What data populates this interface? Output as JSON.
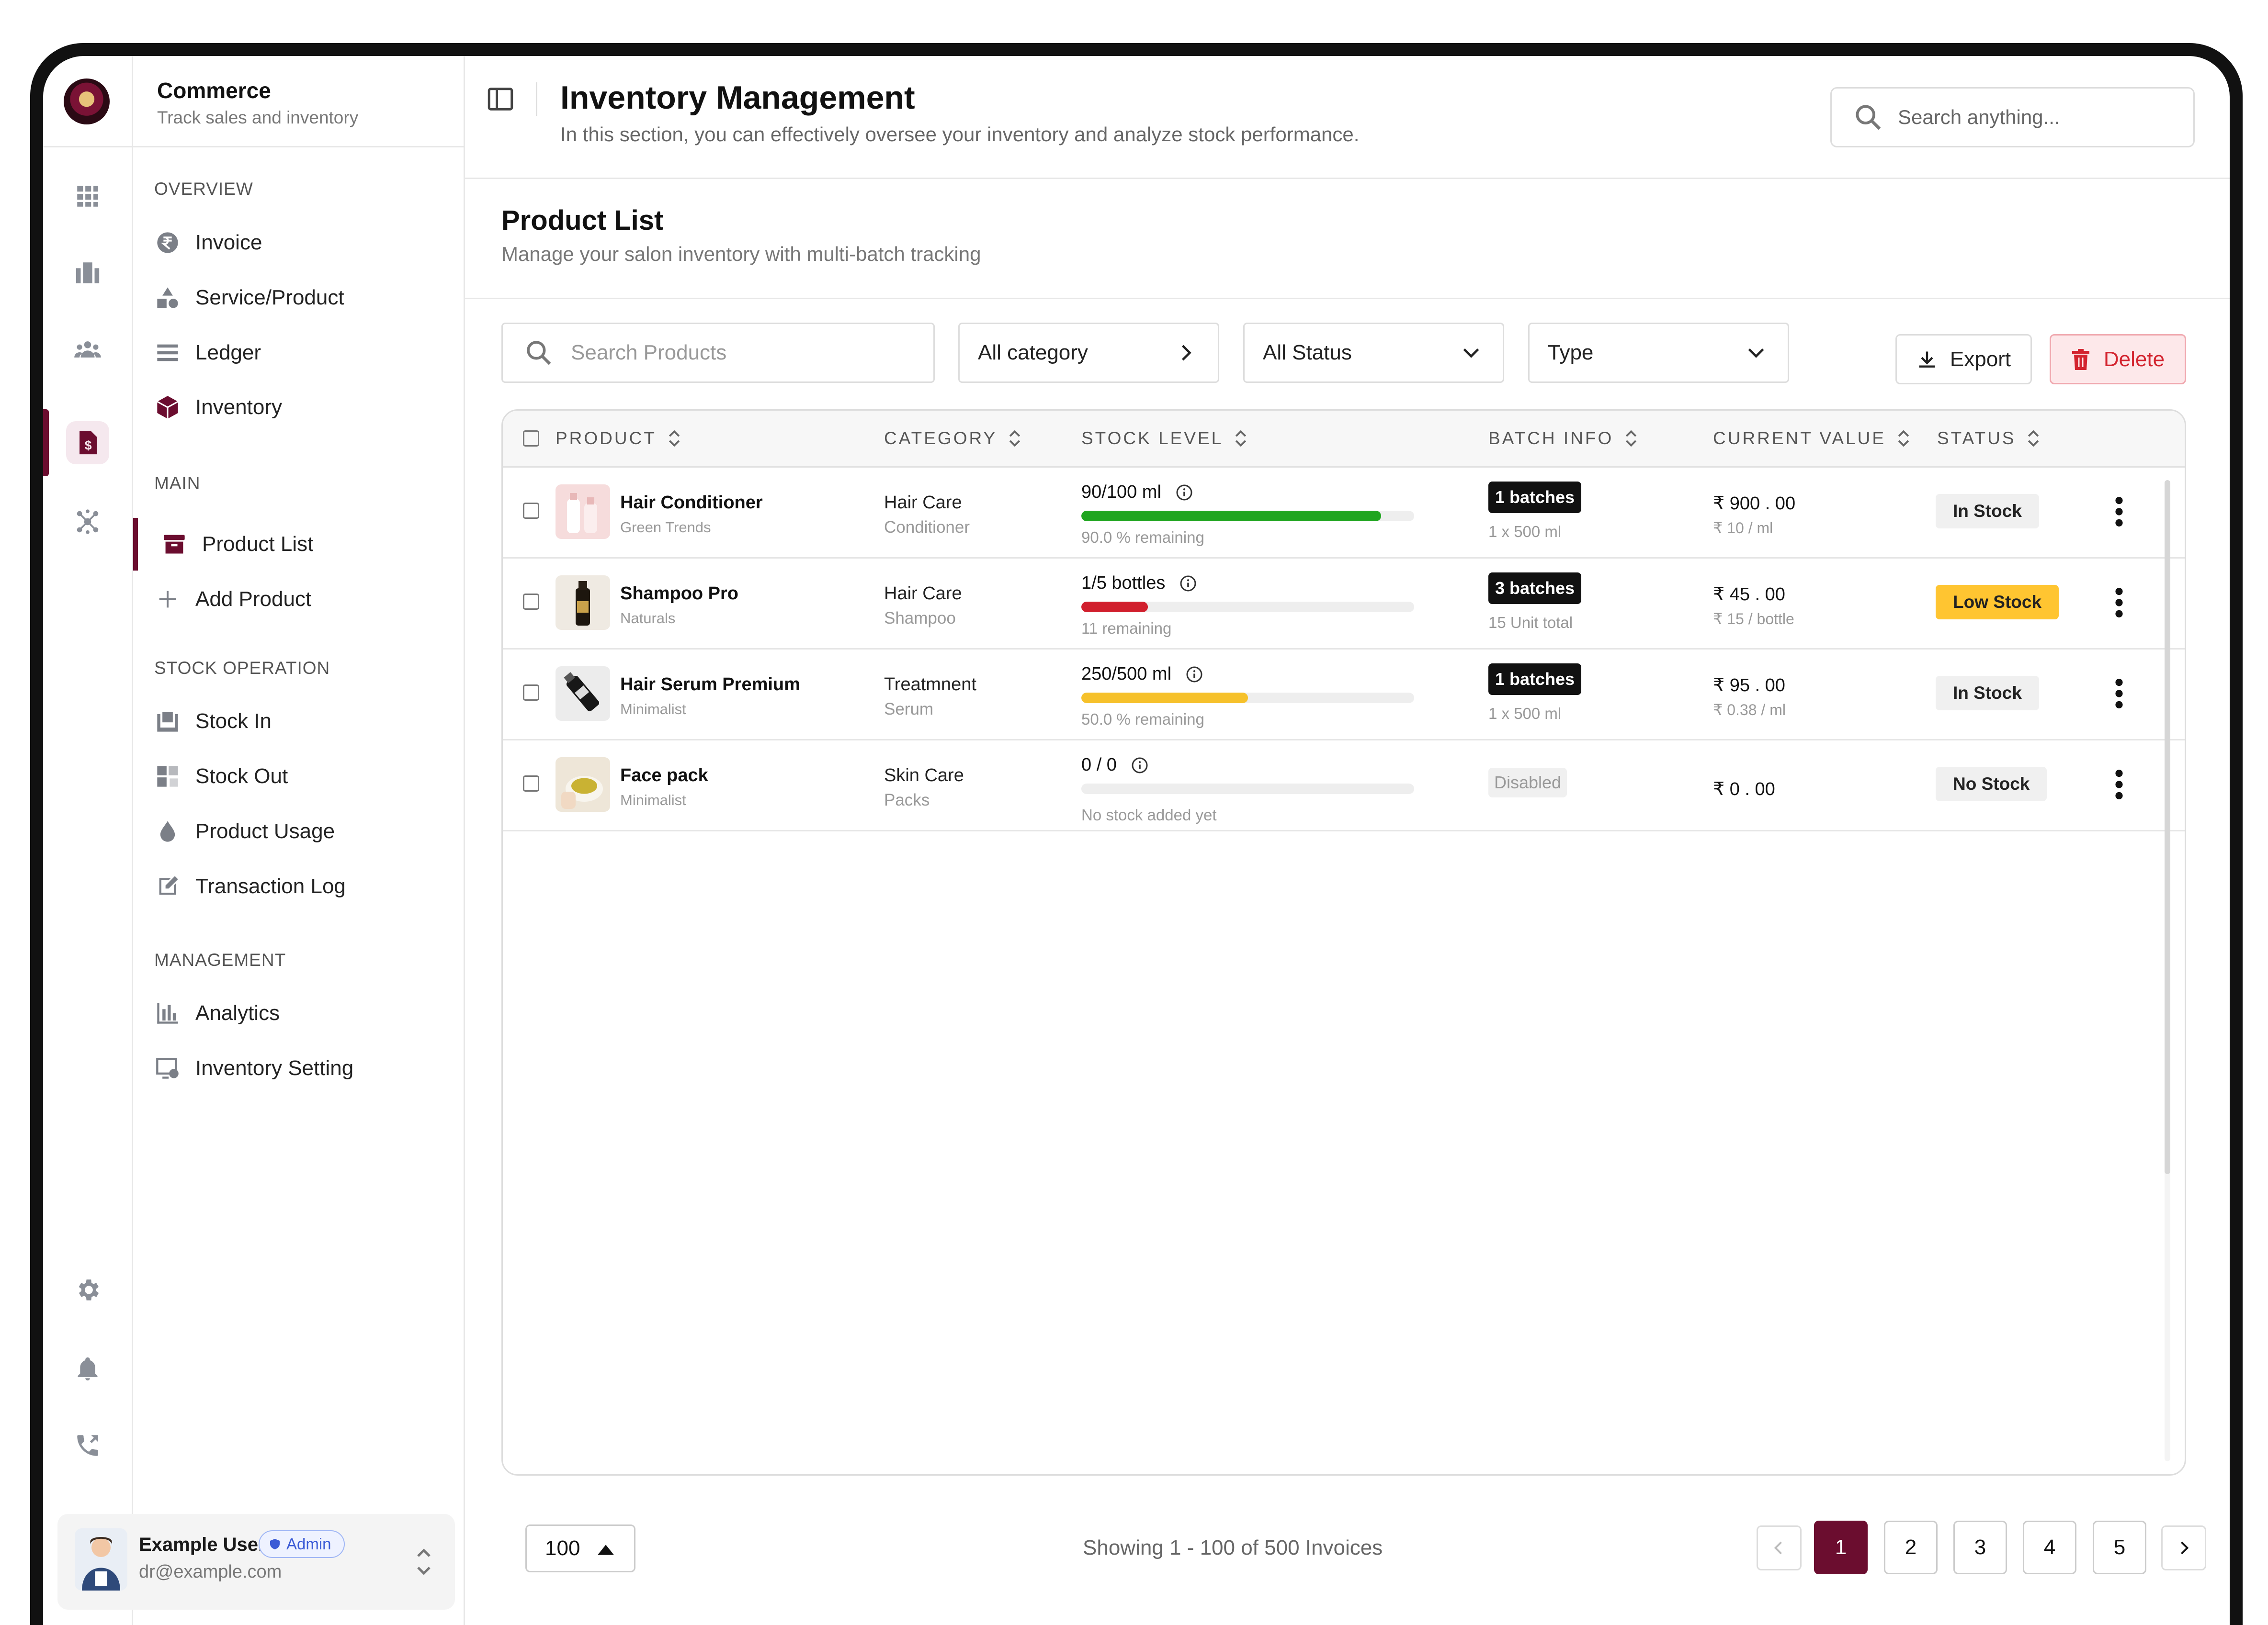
{
  "sidebar": {
    "brand_title": "Commerce",
    "brand_subtitle": "Track sales and inventory",
    "sections": [
      {
        "title": "OVERVIEW",
        "items": [
          {
            "label": "Invoice",
            "icon": "rupee-icon"
          },
          {
            "label": "Service/Product",
            "icon": "shapes-icon"
          },
          {
            "label": "Ledger",
            "icon": "list-icon"
          },
          {
            "label": "Inventory",
            "icon": "box-icon"
          }
        ]
      },
      {
        "title": "MAIN",
        "items": [
          {
            "label": "Product List",
            "icon": "archive-icon",
            "active": true
          },
          {
            "label": "Add Product",
            "icon": "plus-icon"
          }
        ]
      },
      {
        "title": "STOCK OPERATION",
        "items": [
          {
            "label": "Stock In",
            "icon": "tray-in-icon"
          },
          {
            "label": "Stock Out",
            "icon": "tray-out-icon"
          },
          {
            "label": "Product Usage",
            "icon": "drop-icon"
          },
          {
            "label": "Transaction Log",
            "icon": "edit-doc-icon"
          }
        ]
      },
      {
        "title": "MANAGEMENT",
        "items": [
          {
            "label": "Analytics",
            "icon": "bar-chart-icon"
          },
          {
            "label": "Inventory Setting",
            "icon": "settings-screen-icon"
          }
        ]
      }
    ],
    "user": {
      "name": "Example User",
      "role": "Admin",
      "email": "dr@example.com"
    }
  },
  "header": {
    "title": "Inventory Management",
    "subtitle": "In this section, you can effectively oversee your inventory and analyze stock performance.",
    "search_placeholder": "Search anything..."
  },
  "product_list": {
    "title": "Product List",
    "subtitle": "Manage your salon inventory with multi-batch tracking",
    "filters": {
      "search_placeholder": "Search Products",
      "category": "All category",
      "status": "All Status",
      "type": "Type"
    },
    "buttons": {
      "export": "Export",
      "delete": "Delete"
    },
    "columns": [
      "PRODUCT",
      "CATEGORY",
      "STOCK LEVEL",
      "BATCH INFO",
      "CURRENT VALUE",
      "STATUS"
    ],
    "rows": [
      {
        "name": "Hair Conditioner",
        "brand": "Green Trends",
        "category": "Hair Care",
        "subcategory": "Conditioner",
        "stock": "90/100 ml",
        "stock_fraction": 0.9,
        "bar_color": "#1fa51f",
        "remaining": "90.0 % remaining",
        "batch": "1 batches",
        "batch_sub": "1 x 500 ml",
        "value": "₹ 900 . 00",
        "unit_value": "₹ 10 / ml",
        "status": "In Stock",
        "status_type": "in"
      },
      {
        "name": "Shampoo Pro",
        "brand": "Naturals",
        "category": "Hair Care",
        "subcategory": "Shampoo",
        "stock": "1/5 bottles",
        "stock_fraction": 0.2,
        "bar_color": "#d11f2d",
        "remaining": "11 remaining",
        "batch": "3 batches",
        "batch_sub": "15 Unit total",
        "value": "₹ 45 . 00",
        "unit_value": "₹ 15 / bottle",
        "status": "Low Stock",
        "status_type": "low"
      },
      {
        "name": "Hair Serum Premium",
        "brand": "Minimalist",
        "category": "Treatmnent",
        "subcategory": "Serum",
        "stock": "250/500 ml",
        "stock_fraction": 0.5,
        "bar_color": "#f6c12b",
        "remaining": "50.0 % remaining",
        "batch": "1 batches",
        "batch_sub": "1 x 500 ml",
        "value": "₹ 95 . 00",
        "unit_value": "₹ 0.38 / ml",
        "status": "In Stock",
        "status_type": "in"
      },
      {
        "name": "Face pack",
        "brand": "Minimalist",
        "category": "Skin Care",
        "subcategory": "Packs",
        "stock": "0 / 0",
        "stock_fraction": 0,
        "bar_color": "#eeeeee",
        "remaining": "No stock added yet",
        "batch": "Disabled",
        "batch_sub": "",
        "value": "₹ 0 . 00",
        "unit_value": "",
        "status": "No Stock",
        "status_type": "none"
      }
    ]
  },
  "pagination": {
    "per_page": "100",
    "showing": "Showing 1 - 100 of 500 Invoices",
    "pages": [
      "1",
      "2",
      "3",
      "4",
      "5"
    ],
    "current_page": "1"
  },
  "colors": {
    "brand": "#6b0d2f",
    "low_stock": "#ffc531",
    "delete": "#d3242f"
  }
}
